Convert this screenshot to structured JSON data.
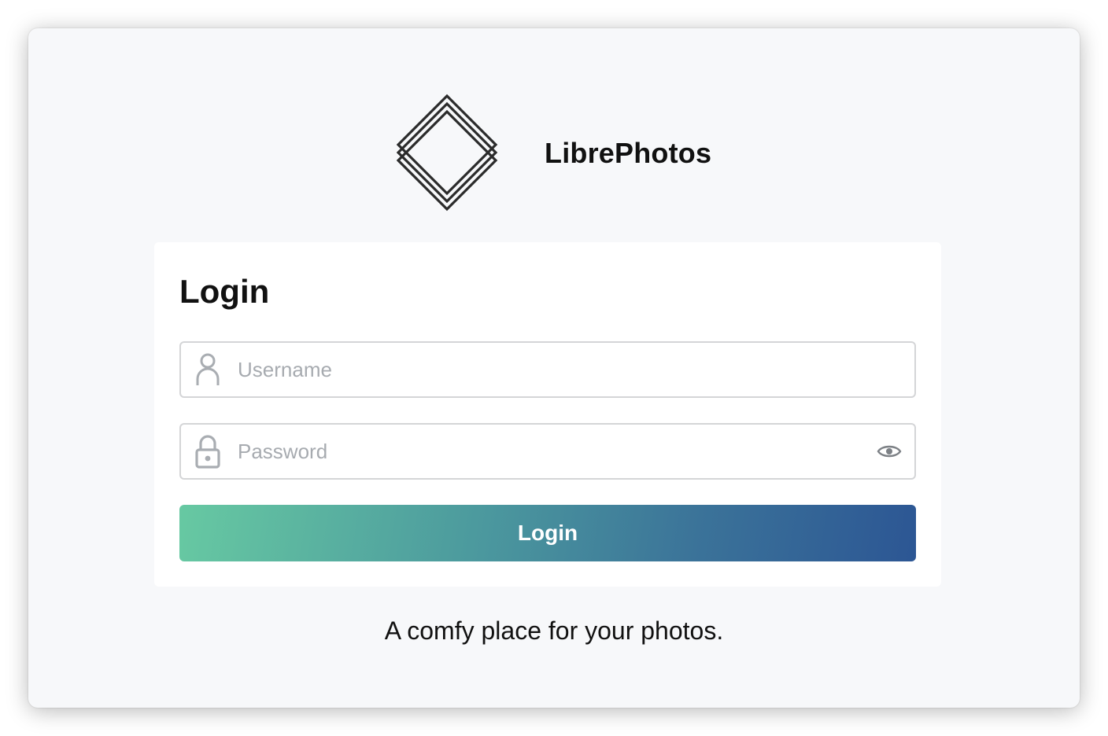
{
  "app": {
    "name": "LibrePhotos",
    "tagline": "A comfy place for your photos."
  },
  "login_form": {
    "title": "Login",
    "username": {
      "value": "",
      "placeholder": "Username",
      "icon": "user-icon"
    },
    "password": {
      "value": "",
      "placeholder": "Password",
      "icon": "lock-icon",
      "toggle_icon": "eye-icon"
    },
    "submit_label": "Login"
  },
  "colors": {
    "window_background": "#f7f8fa",
    "card_background": "#ffffff",
    "button_gradient_start": "#67c9a2",
    "button_gradient_end": "#2c5694",
    "placeholder_text": "#a7abb0",
    "icon_gray": "#a9adb2"
  }
}
